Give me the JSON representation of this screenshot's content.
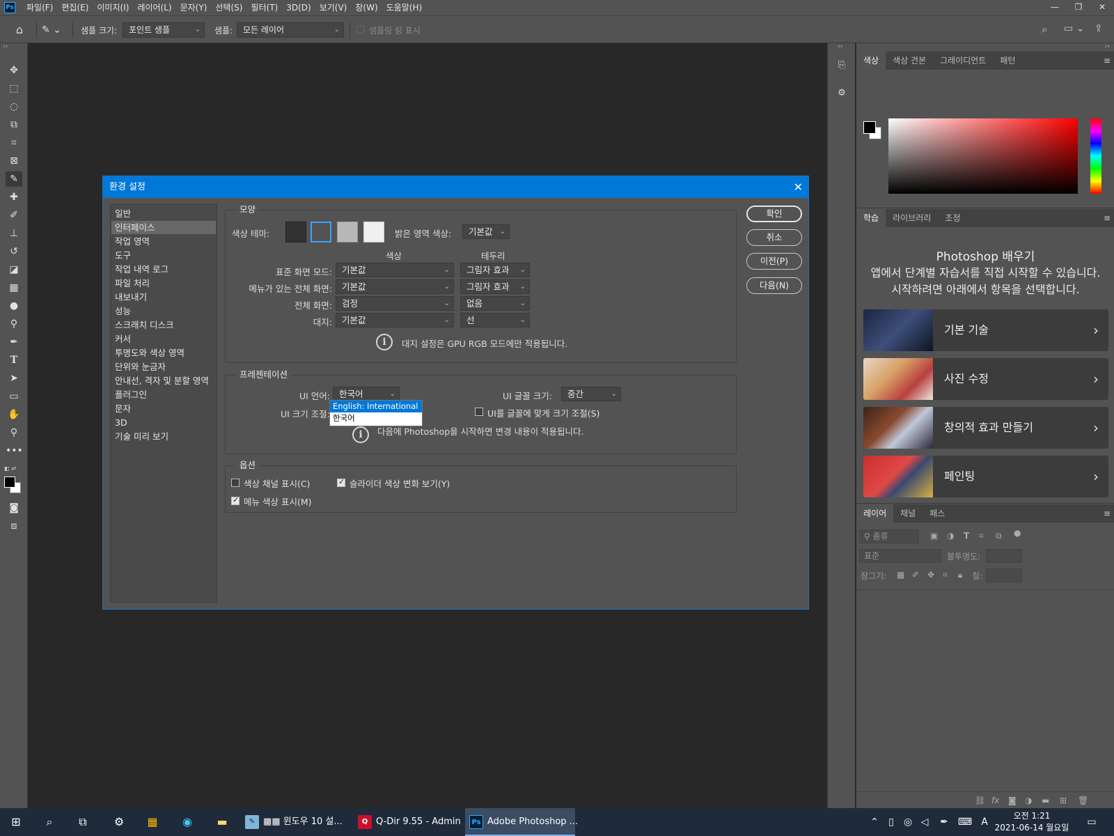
{
  "menu": {
    "items": [
      "파일(F)",
      "편집(E)",
      "이미지(I)",
      "레이어(L)",
      "문자(Y)",
      "선택(S)",
      "필터(T)",
      "3D(D)",
      "보기(V)",
      "창(W)",
      "도움말(H)"
    ]
  },
  "options_bar": {
    "sample_size_label": "샘플 크기:",
    "sample_size_value": "포인트 샘플",
    "sample_label": "샘플:",
    "sample_value": "모든 레이어",
    "show_ring_label": "샘플링 링 표시"
  },
  "color_panel": {
    "tabs": [
      "색상",
      "색상 견본",
      "그레이디언트",
      "패턴"
    ],
    "fg_color": "#000000",
    "bg_color": "#ffffff"
  },
  "learn_panel": {
    "tabs": [
      "학습",
      "라이브러리",
      "조정"
    ],
    "title": "Photoshop 배우기",
    "description": "앱에서 단계별 자습서를 직접 시작할 수 있습니다. 시작하려면 아래에서 항목을 선택합니다.",
    "cards": [
      {
        "label": "기본 기술"
      },
      {
        "label": "사진 수정"
      },
      {
        "label": "창의적 효과 만들기"
      },
      {
        "label": "페인팅"
      }
    ]
  },
  "layers_panel": {
    "tabs": [
      "레이어",
      "채널",
      "패스"
    ],
    "filter_placeholder": "종류",
    "blend_mode": "표준",
    "opacity_label": "불투명도:",
    "lock_label": "잠그기:",
    "fill_label": "칠:"
  },
  "dialog": {
    "title": "환경 설정",
    "nav": [
      "일반",
      "인터페이스",
      "작업 영역",
      "도구",
      "작업 내역 로그",
      "파일 처리",
      "내보내기",
      "성능",
      "스크래치 디스크",
      "커서",
      "투명도와 색상 영역",
      "단위와 눈금자",
      "안내선, 격자 및 분할 영역",
      "플러그인",
      "문자",
      "3D",
      "기술 미리 보기"
    ],
    "active_nav": "인터페이스",
    "appearance": {
      "title": "모양",
      "color_theme_label": "색상 테마:",
      "highlight_color_label": "밝은 영역 색상:",
      "highlight_color_value": "기본값",
      "col_color": "색상",
      "col_border": "테두리",
      "rows": [
        {
          "label": "표준 화면 모드:",
          "color": "기본값",
          "border": "그림자 효과"
        },
        {
          "label": "메뉴가 있는 전체 화면:",
          "color": "기본값",
          "border": "그림자 효과"
        },
        {
          "label": "전체 화면:",
          "color": "검정",
          "border": "없음"
        },
        {
          "label": "대지:",
          "color": "기본값",
          "border": "선"
        }
      ],
      "note": "대지 설정은 GPU RGB 모드에만 적용됩니다."
    },
    "presentation": {
      "title": "프레젠테이션",
      "ui_language_label": "UI 언어:",
      "ui_language_value": "한국어",
      "ui_language_options": [
        "English: International",
        "한국어"
      ],
      "ui_font_size_label": "UI 글꼴 크기:",
      "ui_font_size_value": "중간",
      "ui_scaling_label": "UI 크기 조절:",
      "scale_to_font_label": "UI를 글꼴에 맞게 크기 조절(S)",
      "note": "다음에 Photoshop을 시작하면 변경 내용이 적용됩니다."
    },
    "options": {
      "title": "옵션",
      "show_channels_color": "색상 채널 표시(C)",
      "dynamic_color_sliders": "슬라이더 색상 변화 보기(Y)",
      "show_menu_colors": "메뉴 색상 표시(M)"
    },
    "buttons": {
      "ok": "확인",
      "cancel": "취소",
      "prev": "이전(P)",
      "next": "다음(N)"
    }
  },
  "taskbar": {
    "apps": [
      {
        "label": "▦▦ 윈도우 10 설..."
      },
      {
        "label": "Q-Dir 9.55 - Admin"
      },
      {
        "label": "Adobe Photoshop ..."
      }
    ],
    "time": "오전 1:21",
    "date": "2021-06-14 월요일",
    "ime": "A"
  }
}
